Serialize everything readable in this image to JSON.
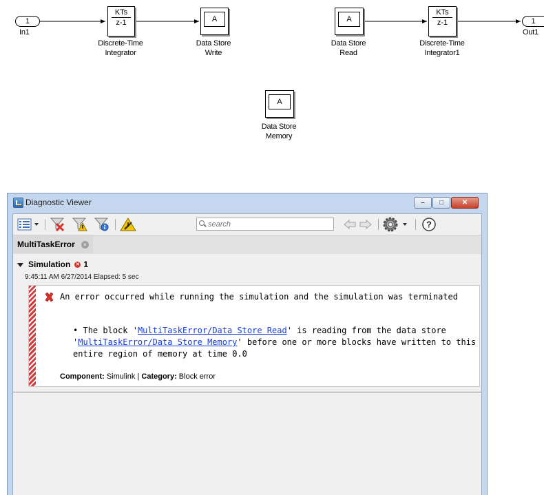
{
  "model": {
    "blocks": {
      "in1": {
        "port_number": "1",
        "label": "In1"
      },
      "integrator": {
        "numerator": "KTs",
        "denominator": "z-1",
        "label_line1": "Discrete-Time",
        "label_line2": "Integrator"
      },
      "ds_write": {
        "symbol": "A",
        "label_line1": "Data Store",
        "label_line2": "Write"
      },
      "ds_read": {
        "symbol": "A",
        "label_line1": "Data Store",
        "label_line2": "Read"
      },
      "integrator1": {
        "numerator": "KTs",
        "denominator": "z-1",
        "label_line1": "Discrete-Time",
        "label_line2": "Integrator1"
      },
      "out1": {
        "port_number": "1",
        "label": "Out1"
      },
      "ds_memory": {
        "symbol": "A",
        "label_line1": "Data Store",
        "label_line2": "Memory"
      }
    }
  },
  "diagnostic_viewer": {
    "title": "Diagnostic Viewer",
    "window_buttons": {
      "minimize": "–",
      "maximize": "□",
      "close": "✕"
    },
    "toolbar": {
      "search_placeholder": "search",
      "icons": [
        "view-menu-icon",
        "filter-errors-icon",
        "filter-warnings-icon",
        "filter-info-icon",
        "highlight-warning-icon",
        "search-icon",
        "back-arrow-icon",
        "forward-arrow-icon",
        "settings-icon",
        "help-icon"
      ]
    },
    "tab": {
      "label": "MultiTaskError",
      "close": "×"
    },
    "simulation": {
      "header": "Simulation",
      "error_count": "1",
      "timestamp": "9:45:11 AM 6/27/2014  Elapsed: 5 sec",
      "message": {
        "main": "An error occurred while running the simulation and the simulation was terminated",
        "detail_bullet": "•",
        "detail_part1": "The block '",
        "detail_link1": "MultiTaskError/Data Store Read",
        "detail_part2": "' is reading from the data store '",
        "detail_link2": "MultiTaskError/Data Store Memory",
        "detail_part3": "' before one or more blocks have written to this entire region of memory at time 0.0",
        "component_label": "Component:",
        "component_value": "Simulink",
        "separator": "|",
        "category_label": "Category:",
        "category_value": "Block error"
      }
    },
    "colors": {
      "error_red": "#d9312a",
      "link_blue": "#1a3cd6",
      "window_frame": "#c4d7ee"
    }
  }
}
